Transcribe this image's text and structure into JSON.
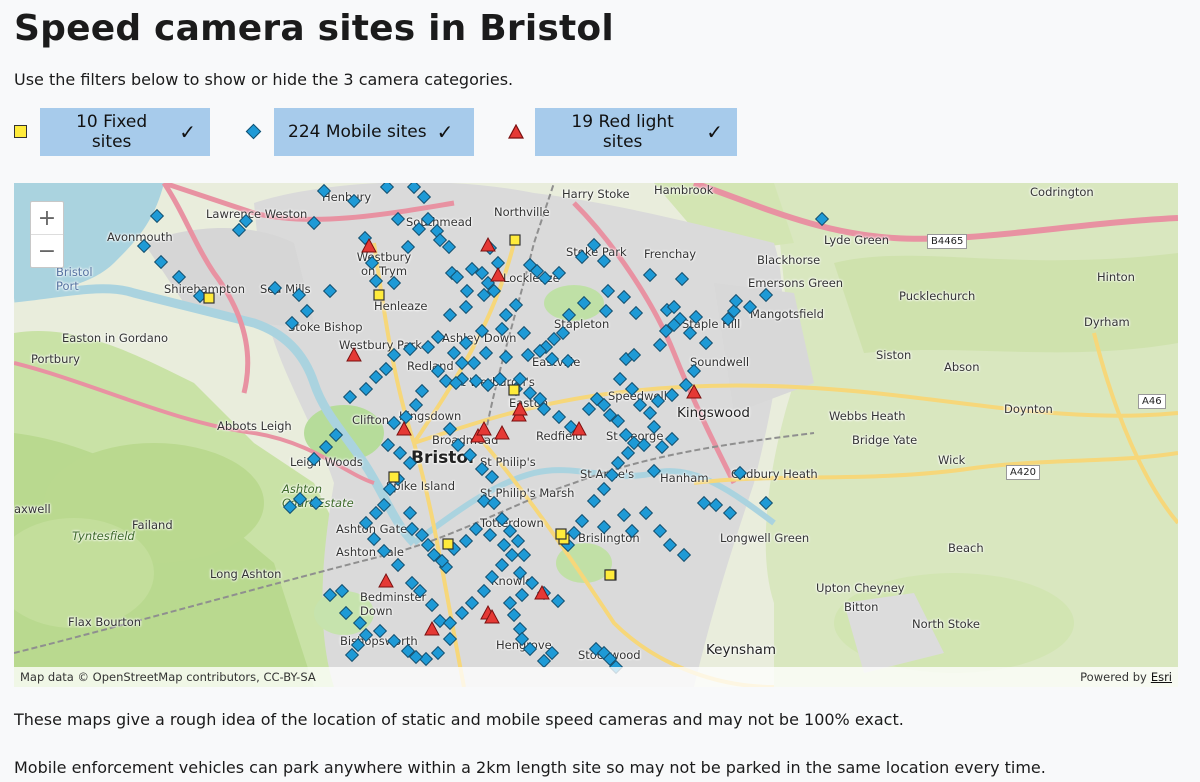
{
  "page": {
    "title": "Speed camera sites in Bristol",
    "intro": "Use the filters below to show or hide the 3 camera categories."
  },
  "filters": [
    {
      "label": "10 Fixed sites",
      "symbol": "square",
      "color": "#ffeb3b",
      "checked": true
    },
    {
      "label": "224 Mobile sites",
      "symbol": "diamond",
      "color": "#1e9ad6",
      "checked": true
    },
    {
      "label": "19 Red light sites",
      "symbol": "triangle",
      "color": "#e53935",
      "checked": true
    }
  ],
  "check_glyph": "✓",
  "map": {
    "zoom_in": "+",
    "zoom_out": "−",
    "attribution": "Map data © OpenStreetMap contributors, CC-BY-SA",
    "powered_by": "Powered by",
    "provider": "Esri",
    "colors": {
      "water": "#aad3df",
      "green": "#c8e0a4",
      "urban": "#d7d7d7",
      "motorway": "#e892a2"
    },
    "places": {
      "henbury": "Henbury",
      "lawrence_weston": "Lawrence Weston",
      "avonmouth": "Avonmouth",
      "bristol_port": "Bristol\nPort",
      "shirehampton": "Shirehampton",
      "sea_mills": "Sea Mills",
      "stoke_bishop": "Stoke Bishop",
      "easton_in_gordano": "Easton in Gordano",
      "portbury": "Portbury",
      "westbury_on_trym": "Westbury on Trym",
      "henleaze": "Henleaze",
      "westbury_park": "Westbury Park",
      "southmead": "Southmead",
      "northville": "Northville",
      "harry_stoke": "Harry Stoke",
      "hambrook": "Hambrook",
      "codrington": "Codrington",
      "lyde_green": "Lyde Green",
      "stoke_park": "Stoke Park",
      "frenchay": "Frenchay",
      "blackhorse": "Blackhorse",
      "emersons_green": "Emersons Green",
      "hinton": "Hinton",
      "pucklechurch": "Pucklechurch",
      "mangotsfield": "Mangotsfield",
      "dyrham": "Dyrham",
      "lockleaze": "Lockleaze",
      "stapleton": "Stapleton",
      "staple_hill": "Staple Hill",
      "ashley_down": "Ashley Down",
      "redland": "Redland",
      "eastville": "Eastville",
      "soundwell": "Soundwell",
      "siston": "Siston",
      "abson": "Abson",
      "st_werburghs": "St Werburgh's",
      "easton": "Easton",
      "speedwell": "Speedwell",
      "kingswood": "Kingswood",
      "webbs_heath": "Webbs Heath",
      "doynton": "Doynton",
      "abbots_leigh": "Abbots Leigh",
      "clifton": "Clifton",
      "kingsdown": "Kingsdown",
      "broadmead": "Broadmead",
      "redfield": "Redfield",
      "st_george": "St George",
      "bridge_yate": "Bridge Yate",
      "leigh_woods": "Leigh Woods",
      "bristol": "Bristol",
      "st_philips": "St Philip's",
      "st_annes": "St Anne's",
      "cadbury_heath": "Cadbury Heath",
      "wick": "Wick",
      "spike_island": "Spike Island",
      "st_philips_marsh": "St Philip's Marsh",
      "hanham": "Hanham",
      "ashton_court_estate": "Ashton\nCourt Estate",
      "failand": "Failand",
      "tyntesfield": "Tyntesfield",
      "ashton_gate": "Ashton Gate",
      "totterdown": "Totterdown",
      "brislington": "Brislington",
      "longwell_green": "Longwell Green",
      "beach": "Beach",
      "ashton_vale": "Ashton Vale",
      "long_ashton": "Long Ashton",
      "knowle": "Knowle",
      "upton_cheyney": "Upton Cheyney",
      "bedminster_down": "Bedminster\nDown",
      "bitton": "Bitton",
      "flax_bourton": "Flax Bourton",
      "north_stoke": "North Stoke",
      "bishopsworth": "Bishopsworth",
      "hengrove": "Hengrove",
      "stockwood": "Stockwood",
      "keynsham": "Keynsham",
      "axwell": "axwell"
    },
    "roads": {
      "b4465": "B4465",
      "a46": "A46",
      "a420": "A420"
    }
  },
  "notes": [
    "These maps give a rough idea of the location of static and mobile speed cameras and may not be 100% exact.",
    "Mobile enforcement vehicles can park anywhere within a 2km length site so may not be parked in the same location every time."
  ]
}
